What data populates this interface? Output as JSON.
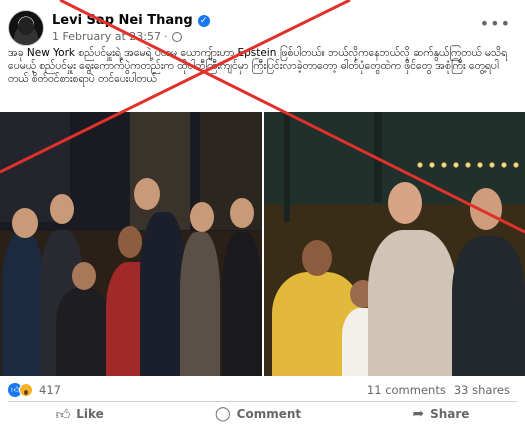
{
  "post": {
    "author": "Levi Sap Nei Thang",
    "timestamp": "1 February at 23:57",
    "text": "အခု New York စည်ပင်မှူးရဲ့ အမေရဲ့ ပထမ ယောကျ်ားဟာ Epstein ဖြစ်ပါတယ်။ ဘယ်လိုကနေဘယ်လို ဆက်နွယ်ကြတယ် မသိရပေမယ့် စည်ပင်မှူး ရွေးကောက်ပွဲကတည်းက ထိုပါတီကြီးကျင်မှာ ကြီးပြင်းလာခဲ့တာတော့ ဓါတ်ပုံတွေထဲက ဖိုင်တွေ အစုံကြီး တွေ့ရပါတယ် စိတ်ဝင်စားစရာပဲ တင်ပေးပါတယ်"
  },
  "reactions": {
    "count": "417",
    "comments": "11 comments",
    "shares": "33 shares"
  },
  "actions": {
    "like": "Like",
    "comment": "Comment",
    "share": "Share"
  },
  "icons": {
    "verified": "verified-badge-icon",
    "privacy": "globe-icon",
    "more": "more-options-icon",
    "like": "thumbs-up-icon",
    "comment": "speech-bubble-icon",
    "share": "share-arrow-icon"
  },
  "colors": {
    "accent": "#1877f2",
    "cross": "#e0312b",
    "muted": "#65676b"
  }
}
